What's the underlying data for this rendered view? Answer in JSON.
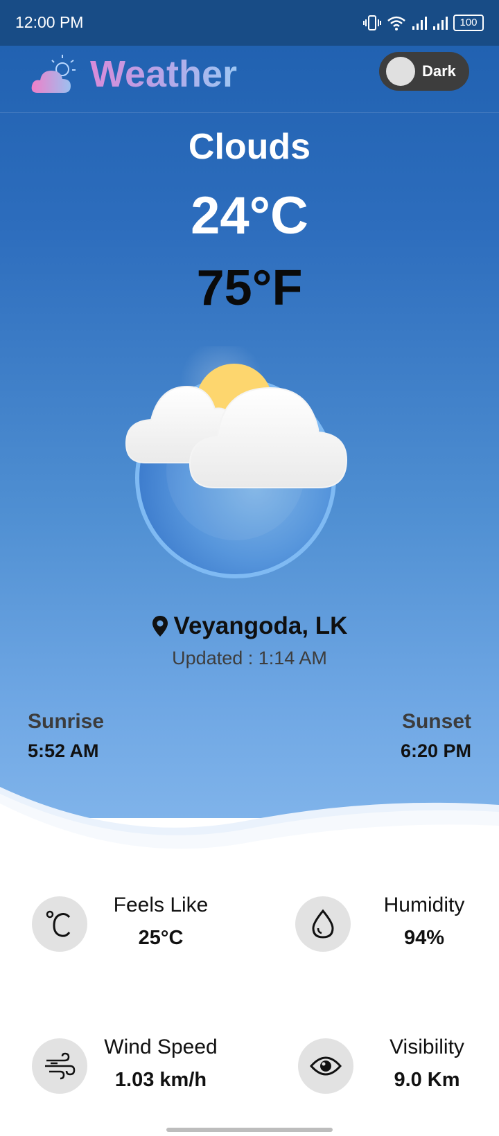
{
  "status_bar": {
    "time": "12:00 PM",
    "battery": "100"
  },
  "header": {
    "title": "Weather",
    "theme_toggle_label": "Dark"
  },
  "current": {
    "condition": "Clouds",
    "temp_c": "24°C",
    "temp_f": "75°F",
    "location": "Veyangoda, LK",
    "updated": "Updated : 1:14 AM"
  },
  "sun": {
    "sunrise_label": "Sunrise",
    "sunrise_time": "5:52 AM",
    "sunset_label": "Sunset",
    "sunset_time": "6:20 PM"
  },
  "stats": {
    "feels_like": {
      "label": "Feels Like",
      "value": "25°C"
    },
    "humidity": {
      "label": "Humidity",
      "value": "94%"
    },
    "wind_speed": {
      "label": "Wind Speed",
      "value": "1.03 km/h"
    },
    "visibility": {
      "label": "Visibility",
      "value": "9.0 Km"
    }
  },
  "icons": {
    "logo": "cloud-sun-icon",
    "location": "map-pin-icon",
    "feels_like": "celsius-icon",
    "humidity": "water-drop-icon",
    "wind_speed": "wind-icon",
    "visibility": "eye-icon"
  },
  "colors": {
    "status_bar": "#184c86",
    "gradient_top": "#1e5fae",
    "gradient_bottom": "#7fb3ea",
    "toggle": "#3d3d3d"
  }
}
